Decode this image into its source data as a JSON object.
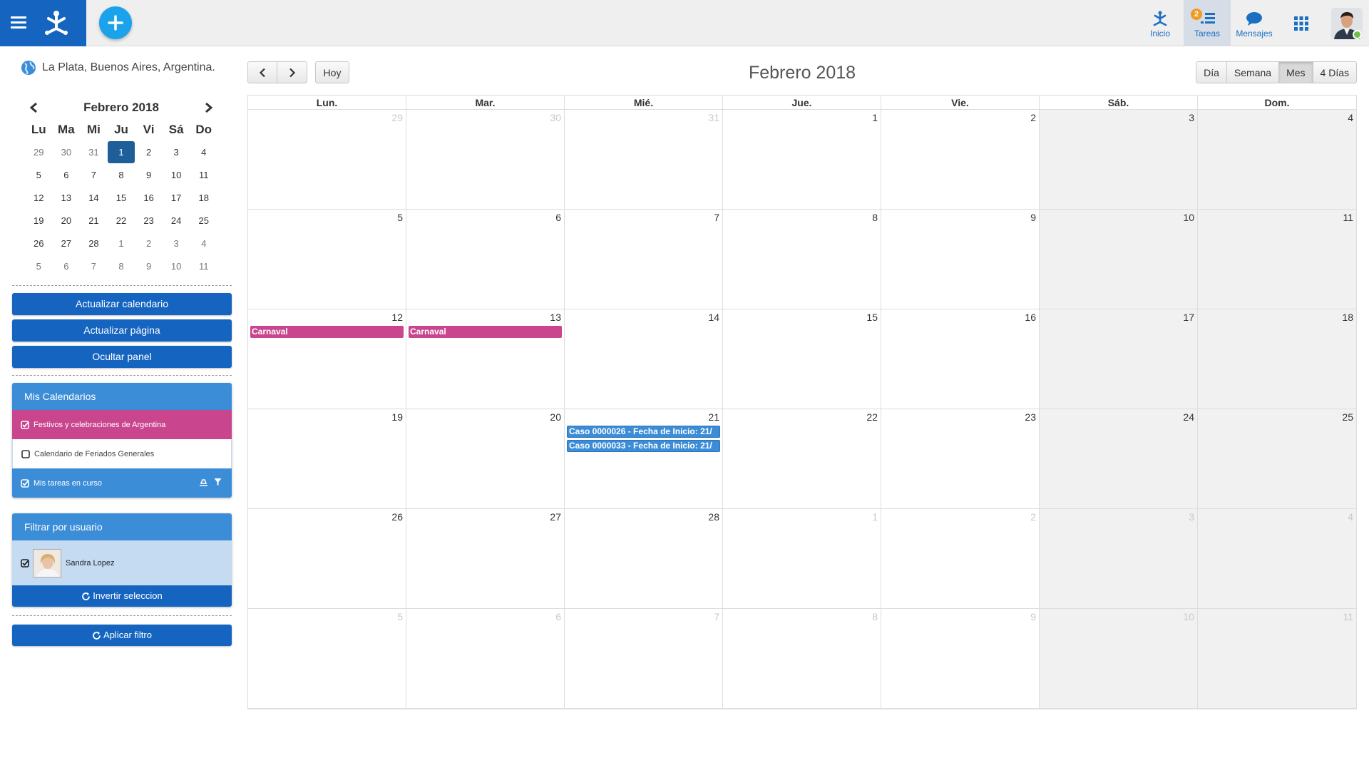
{
  "topbar": {
    "nav": [
      {
        "key": "inicio",
        "label": "Inicio",
        "icon": "home-logo-icon"
      },
      {
        "key": "tareas",
        "label": "Tareas",
        "icon": "tasks-icon",
        "badge": "2",
        "active": true
      },
      {
        "key": "mensajes",
        "label": "Mensajes",
        "icon": "chat-bubble-icon"
      }
    ],
    "apps_icon": "grid-apps-icon",
    "colors": {
      "brand": "#1565c0",
      "add_button": "#1aa3ea",
      "badge": "#f29a1f",
      "online": "#6cc04a"
    }
  },
  "sidebar": {
    "location": "La Plata, Buenos Aires, Argentina.",
    "mini_calendar": {
      "title": "Febrero 2018",
      "dow": [
        "Lu",
        "Ma",
        "Mi",
        "Ju",
        "Vi",
        "Sá",
        "Do"
      ],
      "weeks": [
        [
          "29",
          "30",
          "31",
          "1",
          "2",
          "3",
          "4"
        ],
        [
          "5",
          "6",
          "7",
          "8",
          "9",
          "10",
          "11"
        ],
        [
          "12",
          "13",
          "14",
          "15",
          "16",
          "17",
          "18"
        ],
        [
          "19",
          "20",
          "21",
          "22",
          "23",
          "24",
          "25"
        ],
        [
          "26",
          "27",
          "28",
          "1",
          "2",
          "3",
          "4"
        ],
        [
          "5",
          "6",
          "7",
          "8",
          "9",
          "10",
          "11"
        ]
      ],
      "selected": "1"
    },
    "buttons": {
      "refresh_calendar": "Actualizar calendario",
      "refresh_page": "Actualizar página",
      "hide_panel": "Ocultar panel"
    },
    "my_calendars": {
      "title": "Mis Calendarios",
      "items": [
        {
          "label": "Festivos y celebraciones de Argentina",
          "checked": true,
          "color": "#c9468e"
        },
        {
          "label": "Calendario de Feriados Generales",
          "checked": false,
          "color": "#ffffff"
        },
        {
          "label": "Mis tareas en curso",
          "checked": true,
          "color": "#3c8dd8"
        }
      ]
    },
    "filter_user": {
      "title": "Filtrar por usuario",
      "user": "Sandra Lopez",
      "invert": "Invertir seleccion",
      "apply": "Aplicar filtro"
    }
  },
  "calendar": {
    "title": "Febrero 2018",
    "today": "Hoy",
    "views": [
      {
        "label": "Día",
        "active": false
      },
      {
        "label": "Semana",
        "active": false
      },
      {
        "label": "Mes",
        "active": true
      },
      {
        "label": "4 Días",
        "active": false
      }
    ],
    "dow": [
      "Lun.",
      "Mar.",
      "Mié.",
      "Jue.",
      "Vie.",
      "Sáb.",
      "Dom."
    ],
    "weeks": [
      [
        {
          "d": "29",
          "o": true
        },
        {
          "d": "30",
          "o": true
        },
        {
          "d": "31",
          "o": true
        },
        {
          "d": "1"
        },
        {
          "d": "2"
        },
        {
          "d": "3"
        },
        {
          "d": "4"
        }
      ],
      [
        {
          "d": "5"
        },
        {
          "d": "6"
        },
        {
          "d": "7"
        },
        {
          "d": "8"
        },
        {
          "d": "9"
        },
        {
          "d": "10"
        },
        {
          "d": "11"
        }
      ],
      [
        {
          "d": "12",
          "ev": [
            {
              "t": "Carnaval",
              "c": "pink"
            }
          ]
        },
        {
          "d": "13",
          "ev": [
            {
              "t": "Carnaval",
              "c": "pink"
            }
          ]
        },
        {
          "d": "14"
        },
        {
          "d": "15"
        },
        {
          "d": "16"
        },
        {
          "d": "17"
        },
        {
          "d": "18"
        }
      ],
      [
        {
          "d": "19"
        },
        {
          "d": "20"
        },
        {
          "d": "21",
          "ev": [
            {
              "t": "Caso 0000026 - Fecha de Inicio: 21/",
              "c": "blue"
            },
            {
              "t": "Caso 0000033 - Fecha de Inicio: 21/",
              "c": "blue"
            }
          ]
        },
        {
          "d": "22"
        },
        {
          "d": "23"
        },
        {
          "d": "24"
        },
        {
          "d": "25"
        }
      ],
      [
        {
          "d": "26"
        },
        {
          "d": "27"
        },
        {
          "d": "28"
        },
        {
          "d": "1",
          "o": true
        },
        {
          "d": "2",
          "o": true
        },
        {
          "d": "3",
          "o": true
        },
        {
          "d": "4",
          "o": true
        }
      ],
      [
        {
          "d": "5",
          "o": true
        },
        {
          "d": "6",
          "o": true
        },
        {
          "d": "7",
          "o": true
        },
        {
          "d": "8",
          "o": true
        },
        {
          "d": "9",
          "o": true
        },
        {
          "d": "10",
          "o": true
        },
        {
          "d": "11",
          "o": true
        }
      ]
    ]
  }
}
